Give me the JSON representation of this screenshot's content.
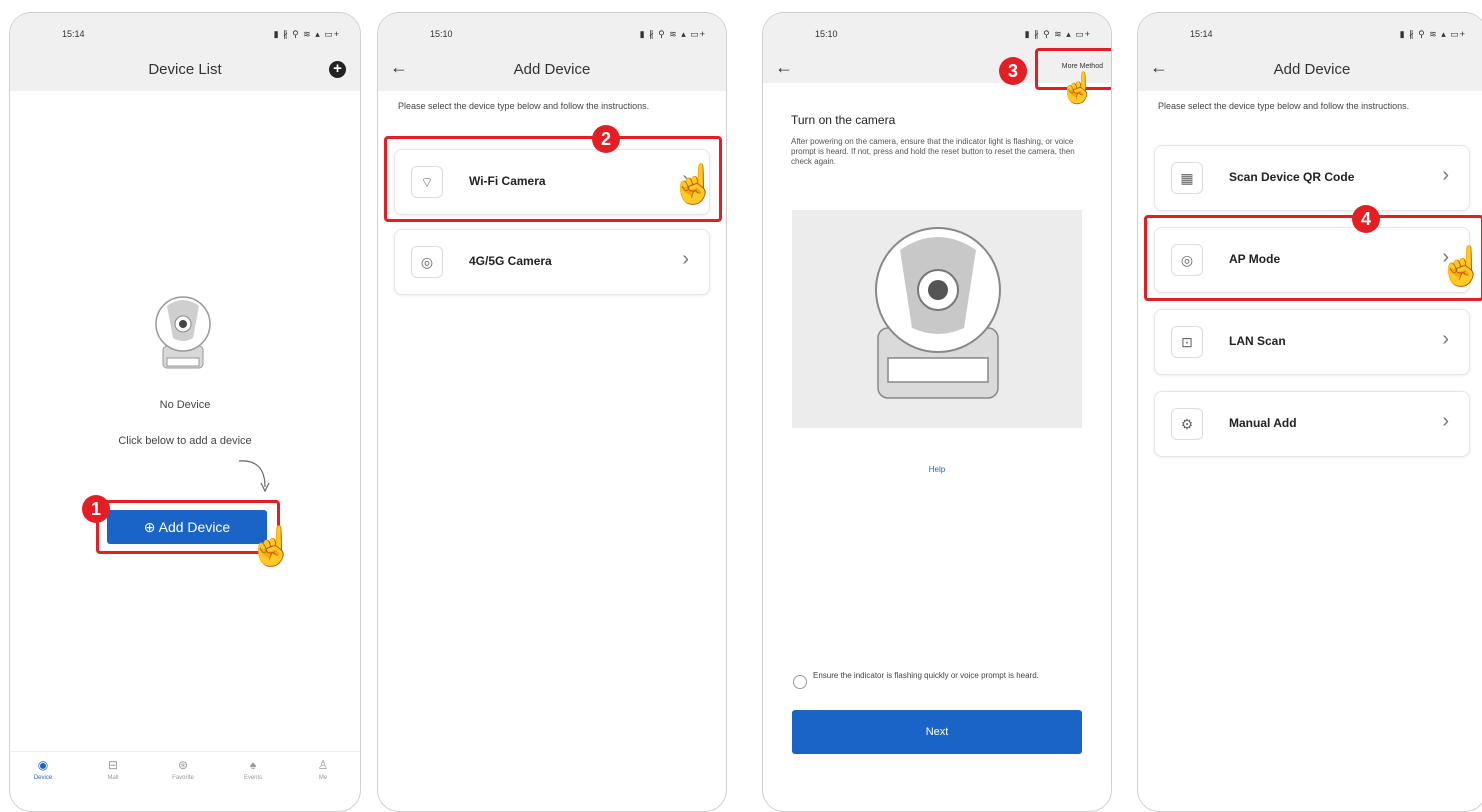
{
  "colors": {
    "accent": "#1a64c8",
    "highlight": "#e31e24"
  },
  "screen1": {
    "time": "15:14",
    "status_icons": "▮ ∦ ⚲ ≋ ▴ ▭+",
    "title": "Device List",
    "plus_icon": "+",
    "no_device": "No Device",
    "click_below": "Click below to add a device",
    "add_device_icon": "⊕",
    "add_device": "Add Device",
    "badge": "1",
    "tabs": [
      {
        "icon": "◉",
        "label": "Device"
      },
      {
        "icon": "⊟",
        "label": "Mall"
      },
      {
        "icon": "⊛",
        "label": "Favorite"
      },
      {
        "icon": "♠",
        "label": "Events"
      },
      {
        "icon": "♙",
        "label": "Me"
      }
    ]
  },
  "screen2": {
    "time": "15:10",
    "status_icons": "▮ ∦ ⚲ ≋ ▴ ▭+",
    "title": "Add Device",
    "instructions": "Please select the device type below and follow the instructions.",
    "items": [
      {
        "icon": "⌔",
        "label": "Wi-Fi Camera"
      },
      {
        "icon": "◎",
        "label": "4G/5G Camera"
      }
    ],
    "badge": "2"
  },
  "screen3": {
    "time": "15:10",
    "status_icons": "▮ ∦ ⚲ ≋ ▴ ▭+",
    "more_method": "More Method",
    "heading": "Turn on the camera",
    "description": "After powering on the camera, ensure that the indicator light is flashing, or voice prompt is heard. If not, press and hold the reset button to reset the camera, then check again.",
    "help": "Help",
    "ensure": "Ensure the indicator is flashing quickly or voice prompt is heard.",
    "next": "Next",
    "badge": "3"
  },
  "screen4": {
    "time": "15:14",
    "status_icons": "▮ ∦ ⚲ ≋ ▴ ▭+",
    "title": "Add Device",
    "instructions": "Please select the device type below and follow the instructions.",
    "items": [
      {
        "icon": "▦",
        "label": "Scan Device QR Code"
      },
      {
        "icon": "◎",
        "label": "AP Mode"
      },
      {
        "icon": "⊡",
        "label": "LAN Scan"
      },
      {
        "icon": "⚙",
        "label": "Manual Add"
      }
    ],
    "badge": "4"
  },
  "common": {
    "back_icon": "←",
    "chevron_icon": "›",
    "hand_icon": "☝"
  }
}
